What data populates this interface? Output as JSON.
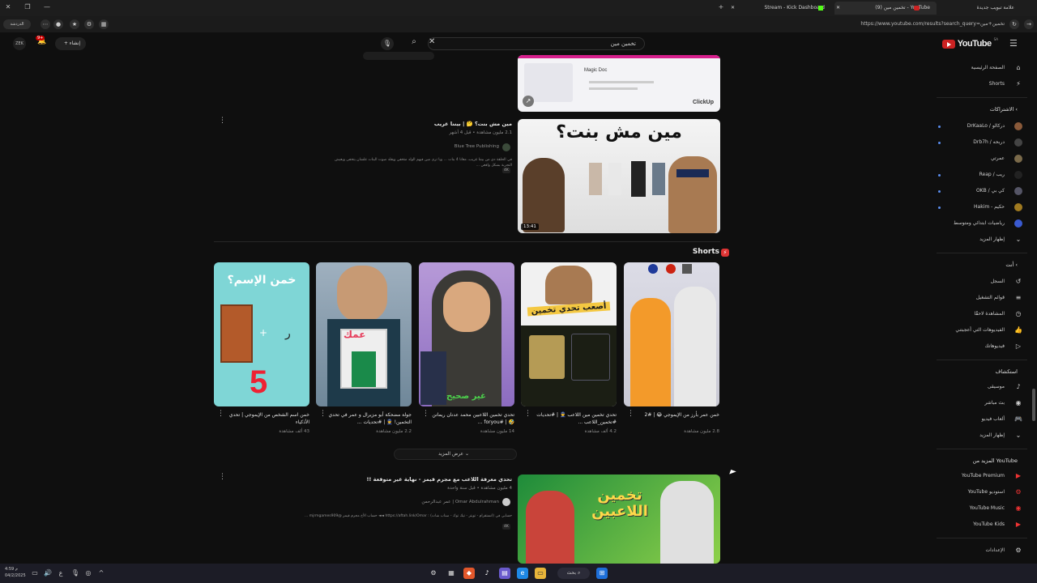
{
  "browser": {
    "tabs": [
      {
        "label": "علامة تبويب جديدة"
      },
      {
        "label": "YouTube - تخمين مين (9)"
      },
      {
        "label": "Stream - Kick Dashboard"
      }
    ],
    "url": "https://www.youtube.com/results?search_query=تخمين+مين",
    "profile_label": "الدردشة"
  },
  "header": {
    "logo_text": "YouTube",
    "logo_sup": "SA",
    "search_value": "تخمين مين",
    "create_label": "إنشاء",
    "notification_count": "9+",
    "avatar_text": "ZEK"
  },
  "sidebar": {
    "main": [
      {
        "label": "الصفحة الرئيسية",
        "icon": "home-icon"
      },
      {
        "label": "Shorts",
        "icon": "shorts-icon"
      }
    ],
    "subscriptions_title": "الاشتراكات",
    "subscriptions": [
      {
        "label": "DrKaaLo / دركالو",
        "color": "#8a5a3a"
      },
      {
        "label": "Drb7h / دربحه",
        "color": "#444"
      },
      {
        "label": "عمرتي",
        "color": "#7a6a4a"
      },
      {
        "label": "Reap / ريب",
        "color": "#222"
      },
      {
        "label": "OKB / كي بي",
        "color": "#556"
      },
      {
        "label": "Hakim - حكيم",
        "color": "#a07a20"
      },
      {
        "label": "رياضيات ابتدائي ومتوسط",
        "color": "#3a5ad0"
      }
    ],
    "show_more_subs": "إظهار المزيد",
    "you_title": "أنت",
    "you": [
      {
        "label": "السجل",
        "icon": "history-icon"
      },
      {
        "label": "قوائم التشغيل",
        "icon": "playlist-icon"
      },
      {
        "label": "المشاهدة لاحقًا",
        "icon": "clock-icon"
      },
      {
        "label": "الفيديوهات التي أعجبتني",
        "icon": "like-icon"
      },
      {
        "label": "فيديوهاتك",
        "icon": "video-icon"
      }
    ],
    "explore_title": "استكشاف",
    "explore": [
      {
        "label": "موسيقى",
        "icon": "music-icon"
      },
      {
        "label": "بث مباشر",
        "icon": "live-icon"
      },
      {
        "label": "ألعاب فيديو",
        "icon": "gaming-icon"
      },
      {
        "label": "إظهار المزيد",
        "icon": "chevron-down-icon"
      }
    ],
    "more_title": "المزيد من YouTube",
    "more": [
      {
        "label": "YouTube Premium"
      },
      {
        "label": "YouTube استوديو"
      },
      {
        "label": "YouTube Music"
      },
      {
        "label": "YouTube Kids"
      }
    ],
    "settings_label": "الإعدادات"
  },
  "ad": {
    "doc_label": "Magic Doc",
    "brand": "ClickUp"
  },
  "videos": [
    {
      "title": "مين مش بنت؟ 🤔 | بيننا غريب",
      "meta": "2.1 مليون مشاهدة • قبل 4 أشهر",
      "channel": "Blue Tree Publishing",
      "desc": "في الحلقة دي من بيننا غريب، معانا 4 بنات ... ويا ترى مين فيهم الولد متخفي ويقلد صوت البنات علشان يتخفى ويعيش التجربة بشكل واقعي ...",
      "badge": "4K",
      "duration": "13:41",
      "thumb_text": "مين مش بنت؟"
    },
    {
      "title": "تحدي معرفة اللاعب مع مجرم قيمز - نهاية غير متوقعة !!",
      "meta": "4 مليون مشاهدة • قبل سنة واحدة",
      "channel": "Omar Abdulrahman | عمر عبدالرحمن",
      "desc": "حسابي في (انستقرام - تويتر - تيك توك - سناب شات) : https://aftah.link/Omar ◄◄ حساب الأخ مجرم قيمز @mjrmgames909 ...",
      "badge": "4K",
      "thumb_text": "تخمين اللاعبين"
    }
  ],
  "shorts_title": "Shorts",
  "shorts": [
    {
      "title": "خمن عمر بأرز من الإيموجي 😂 | #2",
      "views": "2.8 مليون مشاهدة",
      "thumb_text": ""
    },
    {
      "title": "تحدي تخمين مين اللاعب 👮 | #تحديات #تخمين_اللاعب ...",
      "views": "4.2 ألف مشاهدة",
      "thumb_text": "أصعب تحدي تخمين"
    },
    {
      "title": "تحدي تخمين اللاعبين محمد عدنان ريمانن 🤣 | #foryou ...",
      "views": "14 مليون مشاهدة",
      "thumb_text": "غير صحيح"
    },
    {
      "title": "جولة مضحكة أبو مزيرال و عمر في تحدي التخمين! 👮 | #تحديات ...",
      "views": "2.2 مليون مشاهدة",
      "thumb_text": "عمك"
    },
    {
      "title": "خمن اسم الشخص من الإيموجي | تحدي الأذكياء",
      "views": "43 ألف مشاهدة",
      "thumb_text": "خمن الإسم؟"
    }
  ],
  "show_more_label": "عرض المزيد",
  "taskbar": {
    "search_label": "بحث",
    "time": "4:59 م",
    "date": "04/2/2025"
  }
}
